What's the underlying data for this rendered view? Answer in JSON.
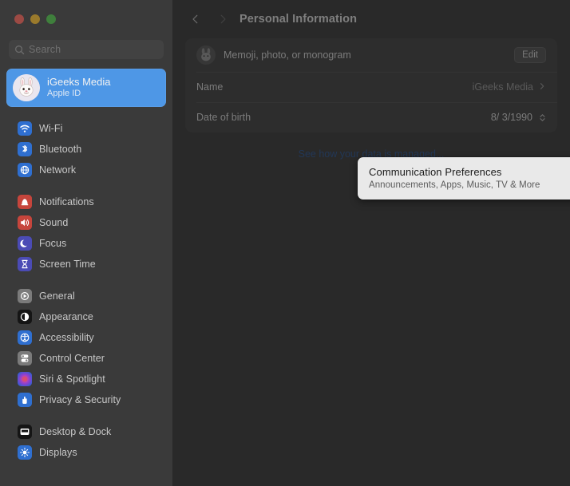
{
  "window": {
    "traffic_lights": [
      "close",
      "minimize",
      "zoom"
    ]
  },
  "sidebar": {
    "search": {
      "placeholder": "Search",
      "icon": "search-icon"
    },
    "account": {
      "name": "iGeeks Media",
      "subtitle": "Apple ID",
      "avatar_icon": "memoji-rabbit-avatar",
      "selected": true,
      "accent": "#4e97e6"
    },
    "groups": [
      {
        "items": [
          {
            "label": "Wi-Fi",
            "icon": "wifi-icon",
            "color": "#2f6fd0"
          },
          {
            "label": "Bluetooth",
            "icon": "bluetooth-icon",
            "color": "#2f6fd0"
          },
          {
            "label": "Network",
            "icon": "network-icon",
            "color": "#2f6fd0"
          }
        ]
      },
      {
        "items": [
          {
            "label": "Notifications",
            "icon": "notifications-icon",
            "color": "#c6453c"
          },
          {
            "label": "Sound",
            "icon": "sound-icon",
            "color": "#c6453c"
          },
          {
            "label": "Focus",
            "icon": "focus-icon",
            "color": "#4b4bb5"
          },
          {
            "label": "Screen Time",
            "icon": "screen-time-icon",
            "color": "#4b4bb5"
          }
        ]
      },
      {
        "items": [
          {
            "label": "General",
            "icon": "general-icon",
            "color": "#7b7b7b"
          },
          {
            "label": "Appearance",
            "icon": "appearance-icon",
            "color": "#151515"
          },
          {
            "label": "Accessibility",
            "icon": "accessibility-icon",
            "color": "#2f6fd0"
          },
          {
            "label": "Control Center",
            "icon": "control-center-icon",
            "color": "#7b7b7b"
          },
          {
            "label": "Siri & Spotlight",
            "icon": "siri-icon",
            "color": "#3d3d6b"
          },
          {
            "label": "Privacy & Security",
            "icon": "privacy-icon",
            "color": "#2f6fd0"
          }
        ]
      },
      {
        "items": [
          {
            "label": "Desktop & Dock",
            "icon": "desktop-dock-icon",
            "color": "#151515"
          },
          {
            "label": "Displays",
            "icon": "displays-icon",
            "color": "#2f6fd0"
          }
        ]
      }
    ]
  },
  "main": {
    "toolbar": {
      "back_icon": "chevron-left-icon",
      "forward_icon": "chevron-right-icon",
      "title": "Personal Information"
    },
    "memoji_row": {
      "label": "Memoji, photo, or monogram",
      "avatar_icon": "memoji-rabbit-avatar",
      "edit_label": "Edit"
    },
    "rows": [
      {
        "label": "Name",
        "value": "iGeeks Media",
        "accessory": "chevron-right-icon"
      },
      {
        "label": "Date of birth",
        "value": "8/ 3/1990",
        "accessory": "stepper-icon"
      }
    ],
    "communication_card": {
      "title": "Communication Preferences",
      "subtitle": "Announcements, Apps, Music, TV & More",
      "info_icon": "info-circle-icon",
      "highlighted": true,
      "background": "#e9e9e9"
    },
    "data_link": {
      "label": "See how your data is managed...",
      "color": "#3b5f94"
    }
  }
}
